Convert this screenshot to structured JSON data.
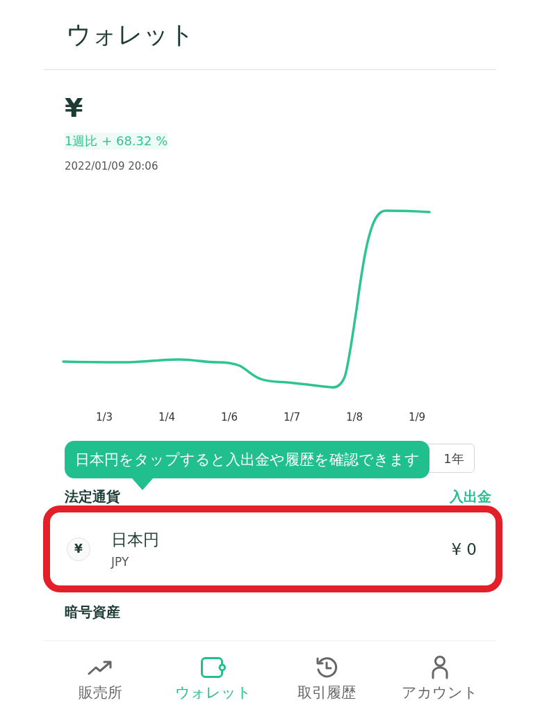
{
  "header": {
    "title": "ウォレット"
  },
  "summary": {
    "balance": "¥",
    "change": "1週比 + 68.32 %",
    "timestamp": "2022/01/09 20:06"
  },
  "chart": {
    "x_labels": [
      "1/3",
      "1/4",
      "1/6",
      "1/7",
      "1/8",
      "1/9"
    ]
  },
  "period_buttons": [
    {
      "label": "1年",
      "selected": false
    }
  ],
  "tooltip": {
    "text": "日本円をタップすると入出金や履歴を確認できます"
  },
  "fiat_section": {
    "title": "法定通貨",
    "action": "入出金",
    "items": [
      {
        "symbol": "¥",
        "name": "日本円",
        "code": "JPY",
        "amount": "¥ 0",
        "highlighted": true
      }
    ]
  },
  "crypto_section": {
    "title": "暗号資産"
  },
  "bottom_nav": [
    {
      "label": "販売所",
      "kind": "trend",
      "selected": false
    },
    {
      "label": "ウォレット",
      "kind": "wallet",
      "selected": true
    },
    {
      "label": "取引履歴",
      "kind": "history",
      "selected": false
    },
    {
      "label": "アカウント",
      "kind": "account",
      "selected": false
    }
  ]
}
